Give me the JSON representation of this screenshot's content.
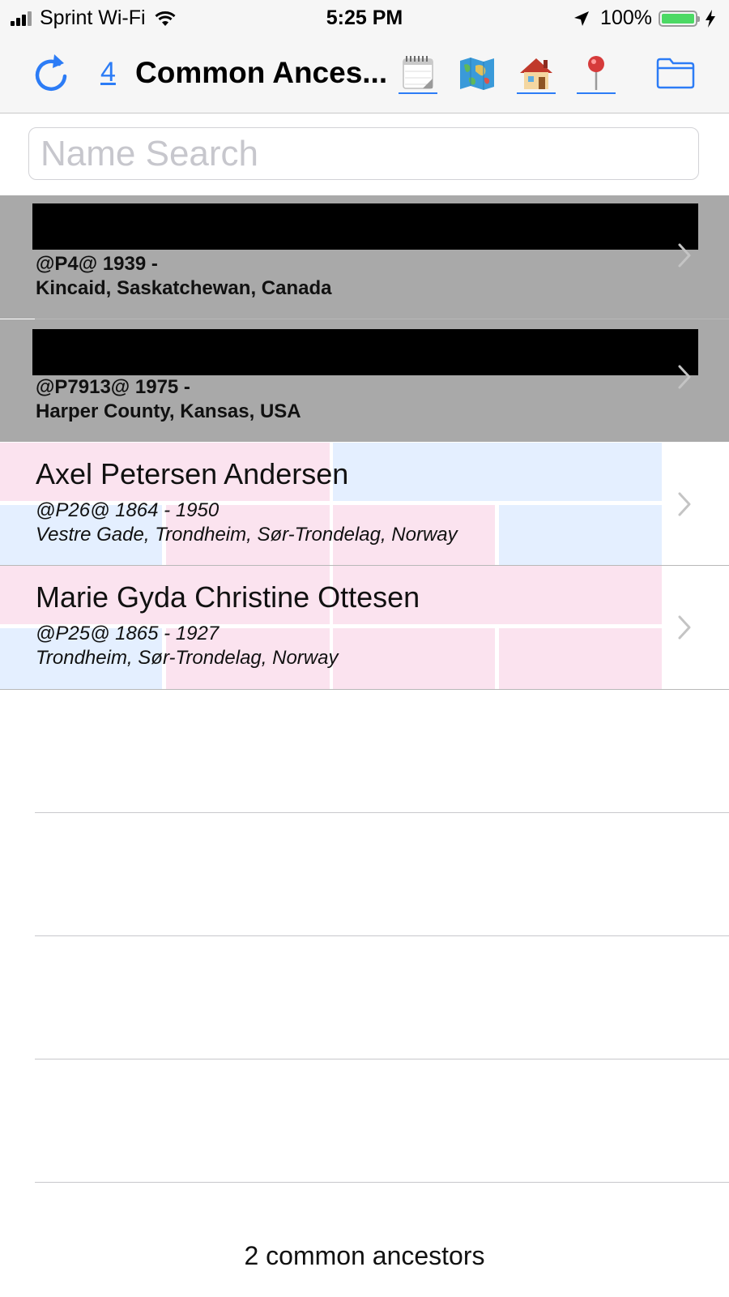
{
  "status": {
    "carrier": "Sprint Wi-Fi",
    "time": "5:25 PM",
    "battery": "100%",
    "battery_level": 1.0
  },
  "nav": {
    "count": "4",
    "title": "Common Ances...",
    "icons": [
      "refresh-icon",
      "calendar-icon",
      "map-icon",
      "house-icon",
      "pin-icon",
      "folder-icon"
    ]
  },
  "search": {
    "placeholder": "Name Search",
    "value": ""
  },
  "people": [
    {
      "name": "",
      "redacted": true,
      "id_dates": "@P4@ 1939 -",
      "place": "Kincaid, Saskatchewan, Canada"
    },
    {
      "name": "",
      "redacted": true,
      "id_dates": "@P7913@ 1975 -",
      "place": "Harper County, Kansas, USA"
    },
    {
      "name": "Axel Petersen Andersen",
      "redacted": false,
      "id_dates": "@P26@ 1864 -  1950",
      "place": "Vestre Gade, Trondheim, Sør-Trondelag, Norway"
    },
    {
      "name": "Marie Gyda Christine Ottesen",
      "redacted": false,
      "id_dates": "@P25@ 1865 -  1927",
      "place": "Trondheim, Sør-Trondelag, Norway"
    }
  ],
  "colors": {
    "accent": "#2c7cf6",
    "highlight_row": "#a9a9a9",
    "pink": "#fbe3ef",
    "blue": "#e4efff"
  },
  "footer": "2 common ancestors"
}
